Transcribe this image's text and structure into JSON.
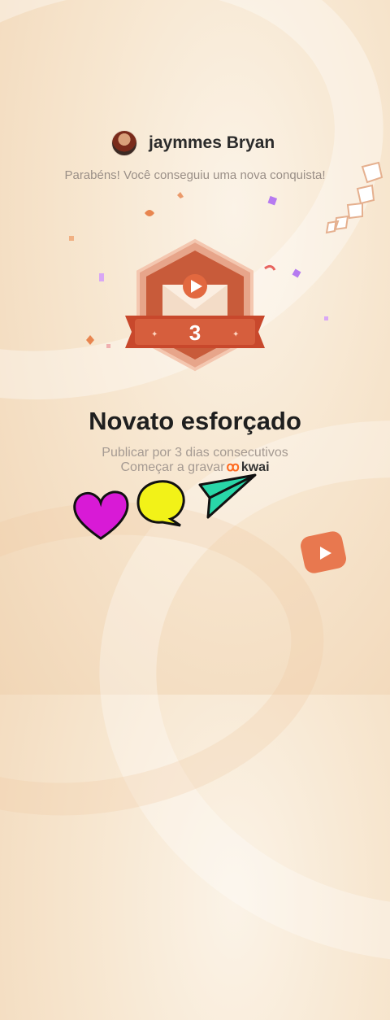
{
  "header": {
    "username": "jaymmes Bryan",
    "message": "Parabéns! Você conseguiu uma nova conquista!"
  },
  "badge": {
    "level": "3",
    "icon": "play-icon"
  },
  "achievement": {
    "title": "Novato esforçado",
    "description": "Publicar por 3 dias consecutivos"
  },
  "cta": {
    "label": "Começar a gravar",
    "brand": "kwai"
  },
  "reactions": [
    "heart-icon",
    "comment-icon",
    "share-icon"
  ],
  "colors": {
    "badge_orange": "#d9673f",
    "heart": "#d81ad6",
    "comment": "#f2f218",
    "share": "#29d6a8"
  }
}
